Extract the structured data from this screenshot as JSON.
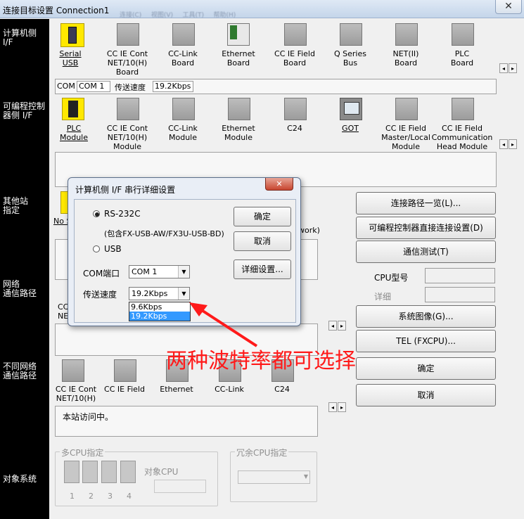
{
  "window": {
    "title": "连接目标设置 Connection1",
    "close_glyph": "✕",
    "menu_items": [
      "连接(C)",
      "视图(V)",
      "工具(T)",
      "帮助(H)"
    ]
  },
  "sidebar": {
    "pc_if": "计算机侧\nI/F",
    "plc_if": "可编程控制\n器侧 I/F",
    "other_station": "其他站\n指定",
    "network_route": "网络\n通信路径",
    "diff_network_route": "不同网络\n通信路径",
    "target_system": "对象系统"
  },
  "pc_if_tiles": [
    "Serial\nUSB",
    "CC IE Cont\nNET/10(H)\nBoard",
    "CC-Link\nBoard",
    "Ethernet\nBoard",
    "CC IE Field\nBoard",
    "Q Series\nBus",
    "NET(II)\nBoard",
    "PLC\nBoard"
  ],
  "pc_status": {
    "com_label": "COM",
    "com_value": "COM 1",
    "speed_label": "传送速度",
    "speed_value": "19.2Kbps"
  },
  "plc_if_tiles": [
    "PLC\nModule",
    "CC IE Cont\nNET/10(H)\nModule",
    "CC-Link\nModule",
    "Ethernet\nModule",
    "C24",
    "GOT",
    "CC IE Field\nMaster/Local\nModule",
    "CC IE Field\nCommunication\nHead Module"
  ],
  "other_station": {
    "tile_label": "No S",
    "network_suffix": "work)"
  },
  "network_route": {
    "tile_label_partial": "CC\nNE"
  },
  "diff_network_tiles": [
    "CC IE Cont\nNET/10(H)",
    "CC IE Field",
    "Ethernet",
    "CC-Link",
    "C24"
  ],
  "status_text": "本站访问中。",
  "multi_cpu": {
    "legend": "多CPU指定",
    "numbers": [
      "1",
      "2",
      "3",
      "4"
    ],
    "target_cpu_label": "对象CPU"
  },
  "redundant_cpu": {
    "legend": "冗余CPU指定"
  },
  "right_buttons": {
    "route_list": "连接路径一览(L)...",
    "plc_direct": "可编程控制器直接连接设置(D)",
    "comm_test": "通信测试(T)",
    "cpu_model_label": "CPU型号",
    "detail_label": "详细",
    "system_image": "系统图像(G)...",
    "tel": "TEL (FXCPU)...",
    "ok": "确定",
    "cancel": "取消"
  },
  "dialog": {
    "title": "计算机侧 I/F 串行详细设置",
    "close_glyph": "✕",
    "rs232c_label": "RS-232C",
    "rs232c_note": "(包含FX-USB-AW/FX3U-USB-BD)",
    "usb_label": "USB",
    "com_port_label": "COM端口",
    "com_port_value": "COM 1",
    "speed_label": "传送速度",
    "speed_value": "19.2Kbps",
    "speed_options": [
      "9.6Kbps",
      "19.2Kbps"
    ],
    "ok": "确定",
    "cancel": "取消",
    "detail": "详细设置..."
  },
  "annotation": {
    "text": "两种波特率都可选择",
    "color": "#ff1a1a"
  },
  "arrows": {
    "left": "◂",
    "right": "▸",
    "down": "▼"
  }
}
